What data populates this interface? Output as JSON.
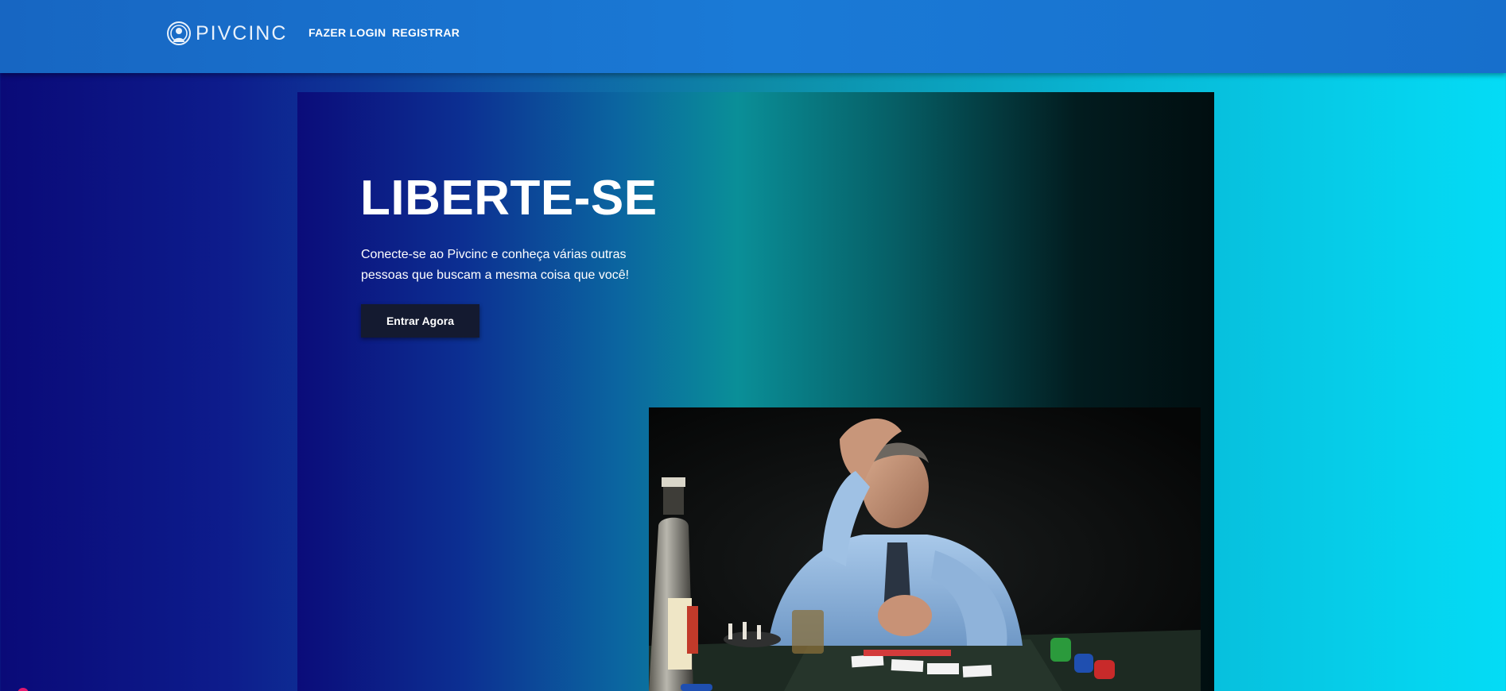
{
  "navbar": {
    "logo_text": "PIVCINC",
    "logo_icon": "person-broadcast-icon",
    "links": [
      {
        "label": "FAZER LOGIN"
      },
      {
        "label": "REGISTRAR"
      }
    ]
  },
  "hero": {
    "title": "LIBERTE-SE",
    "subtitle": "Conecte-se ao Pivcinc e conheça várias outras pessoas que buscam a mesma coisa que você!",
    "cta_label": "Entrar Agora",
    "image": "photo of a distressed man at a poker table with a whiskey bottle, cards and chips"
  },
  "colors": {
    "navbar": "#1a7ad6",
    "background_left": "#0a0a78",
    "background_right": "#04dcf6",
    "cta_background": "#141a30",
    "text": "#ffffff"
  }
}
